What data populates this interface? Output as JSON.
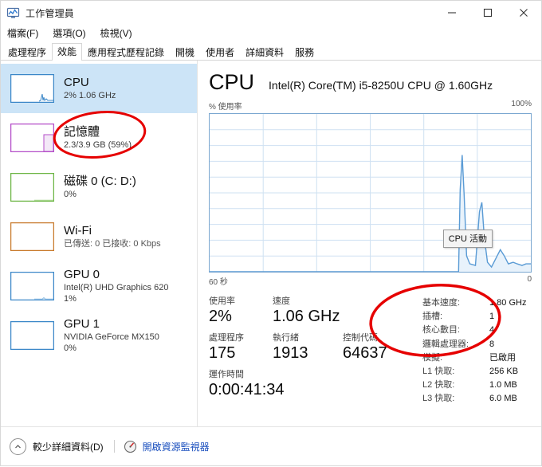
{
  "window": {
    "title": "工作管理員",
    "icon": "task-manager-icon",
    "minimize": "—",
    "maximize": "□",
    "close": "✕"
  },
  "menu": {
    "items": [
      {
        "label": "檔案(F)"
      },
      {
        "label": "選項(O)"
      },
      {
        "label": "檢視(V)"
      }
    ]
  },
  "tabs": {
    "selected": "效能",
    "items": [
      {
        "label": "處理程序",
        "selected": false
      },
      {
        "label": "效能",
        "selected": true
      },
      {
        "label": "應用程式歷程記錄",
        "selected": false
      },
      {
        "label": "開機",
        "selected": false
      },
      {
        "label": "使用者",
        "selected": false
      },
      {
        "label": "詳細資料",
        "selected": false
      },
      {
        "label": "服務",
        "selected": false
      }
    ]
  },
  "sidebar": {
    "items": [
      {
        "name": "cpu",
        "title": "CPU",
        "sub1": "2%  1.06 GHz",
        "sub2": "",
        "color": "#3b87c8",
        "selected": true
      },
      {
        "name": "memory",
        "title": "記憶體",
        "sub1": "2.3/3.9 GB (59%)",
        "sub2": "",
        "color": "#b44ec8",
        "selected": false
      },
      {
        "name": "disk-0",
        "title": "磁碟 0 (C: D:)",
        "sub1": "0%",
        "sub2": "",
        "color": "#6cb544",
        "selected": false
      },
      {
        "name": "wifi",
        "title": "Wi-Fi",
        "sub1": "已傳送: 0  已接收: 0 Kbps",
        "sub2": "",
        "color": "#c87a2c",
        "selected": false
      },
      {
        "name": "gpu-0",
        "title": "GPU 0",
        "sub1": "Intel(R) UHD Graphics 620",
        "sub2": "1%",
        "color": "#3b87c8",
        "selected": false
      },
      {
        "name": "gpu-1",
        "title": "GPU 1",
        "sub1": "NVIDIA GeForce MX150",
        "sub2": "0%",
        "color": "#3b87c8",
        "selected": false
      }
    ]
  },
  "main": {
    "title": "CPU",
    "subtitle": "Intel(R) Core(TM) i5-8250U CPU @ 1.60GHz",
    "graph": {
      "y_label": "% 使用率",
      "y_max_label": "100%",
      "x_left_label": "60 秒",
      "x_right_label": "0",
      "tooltip": "CPU 活動",
      "line_color": "#5a9bd5",
      "fill_color": "#e8f2fb",
      "grid_color": "#cfe1f2"
    },
    "stats": {
      "usage_label": "使用率",
      "usage_value": "2%",
      "speed_label": "速度",
      "speed_value": "1.06 GHz",
      "processes_label": "處理程序",
      "processes_value": "175",
      "threads_label": "執行緒",
      "threads_value": "1913",
      "handles_label": "控制代碼",
      "handles_value": "64637",
      "uptime_label": "運作時間",
      "uptime_value": "0:00:41:34"
    },
    "specs": [
      {
        "key": "基本速度:",
        "value": "1.80 GHz"
      },
      {
        "key": "插槽:",
        "value": "1"
      },
      {
        "key": "核心數目:",
        "value": "4"
      },
      {
        "key": "邏輯處理器:",
        "value": "8"
      },
      {
        "key": "模擬:",
        "value": "已啟用"
      },
      {
        "key": "L1 快取:",
        "value": "256 KB"
      },
      {
        "key": "L2 快取:",
        "value": "1.0 MB"
      },
      {
        "key": "L3 快取:",
        "value": "6.0 MB"
      }
    ]
  },
  "footer": {
    "fewer_details": "較少詳細資料(D)",
    "resource_monitor": "開啟資源監視器"
  },
  "annotations": {
    "color": "#e60000",
    "ellipses": [
      {
        "name": "memory-item-highlight",
        "cx": 124,
        "cy": 168,
        "rx": 57,
        "ry": 28,
        "rotate": -6
      },
      {
        "name": "cpu-specs-highlight",
        "cx": 545,
        "cy": 401,
        "rx": 81,
        "ry": 44,
        "rotate": -4
      }
    ]
  },
  "chart_data": {
    "type": "line",
    "title": "% 使用率",
    "xlabel": "60 秒",
    "ylabel": "% 使用率",
    "ylim": [
      0,
      100
    ],
    "xlim": [
      60,
      0
    ],
    "grid": true,
    "series": [
      {
        "name": "CPU 使用率",
        "points": [
          [
            60,
            0
          ],
          [
            56,
            0
          ],
          [
            52,
            0
          ],
          [
            48,
            0
          ],
          [
            44,
            0
          ],
          [
            40,
            0
          ],
          [
            36,
            0
          ],
          [
            32,
            0
          ],
          [
            28,
            0
          ],
          [
            24,
            0
          ],
          [
            20,
            0
          ],
          [
            16,
            0
          ],
          [
            13.5,
            0
          ],
          [
            13.0,
            52
          ],
          [
            12.6,
            74
          ],
          [
            12.2,
            48
          ],
          [
            11.8,
            10
          ],
          [
            11.2,
            5
          ],
          [
            10.2,
            4
          ],
          [
            9.4,
            38
          ],
          [
            9.0,
            44
          ],
          [
            8.6,
            22
          ],
          [
            8.0,
            6
          ],
          [
            7.2,
            3
          ],
          [
            6.4,
            9
          ],
          [
            5.6,
            14
          ],
          [
            4.8,
            10
          ],
          [
            4.0,
            5
          ],
          [
            3.2,
            4
          ],
          [
            2.4,
            6
          ],
          [
            1.6,
            5
          ],
          [
            0.8,
            4
          ],
          [
            0,
            5
          ]
        ]
      }
    ]
  }
}
